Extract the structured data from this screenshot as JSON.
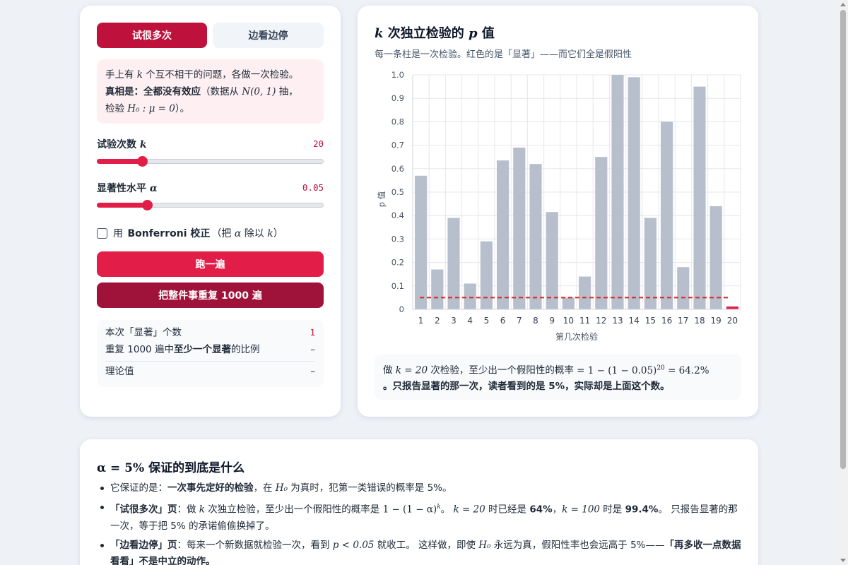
{
  "tabs": {
    "many": "试很多次",
    "peek": "边看边停"
  },
  "intro": {
    "l1a": "手上有",
    "l1k": "k",
    "l1b": "个互不相干的问题，各做一次检验。",
    "l2bold": "真相是：全都没有效应",
    "l2a": "（数据从",
    "l2math": "N(0, 1)",
    "l2b": "抽，",
    "l3a": "检验",
    "l3math": "H₀ : μ = 0",
    "l3b": "）。"
  },
  "controls": {
    "k_label": "试验次数",
    "k_sym": "k",
    "k_value": "20",
    "k_fraction": 0.2,
    "alpha_label": "显著性水平",
    "alpha_sym": "α",
    "alpha_value": "0.05",
    "alpha_fraction": 0.22,
    "bonf_a": "用",
    "bonf_b": "Bonferroni 校正",
    "bonf_c": "（把",
    "bonf_alpha": "α",
    "bonf_d": "除以",
    "bonf_k": "k",
    "bonf_e": "）",
    "bonf_checked": false
  },
  "buttons": {
    "run": "跑一遍",
    "repeat": "把整件事重复 1000 遍"
  },
  "stats": {
    "count_label": "本次「显著」个数",
    "count_value": "1",
    "ratio_a": "重复 1000 遍中",
    "ratio_bold": "至少一个显著",
    "ratio_b": "的比例",
    "ratio_value": "–",
    "theory_label": "理论值",
    "theory_value": "–"
  },
  "chart_header": {
    "title_k": "k",
    "title_a": " 次独立检验的 ",
    "title_p": "p",
    "title_b": " 值",
    "subtitle": "每一条柱是一次检验。红色的是「显著」——而它们全是假阳性"
  },
  "chart_data": {
    "type": "bar",
    "categories": [
      "1",
      "2",
      "3",
      "4",
      "5",
      "6",
      "7",
      "8",
      "9",
      "10",
      "11",
      "12",
      "13",
      "14",
      "15",
      "16",
      "17",
      "18",
      "19",
      "20"
    ],
    "values": [
      0.57,
      0.17,
      0.39,
      0.11,
      0.29,
      0.635,
      0.69,
      0.62,
      0.415,
      0.05,
      0.14,
      0.65,
      1.0,
      0.99,
      0.39,
      0.8,
      0.18,
      0.95,
      0.44,
      0.012
    ],
    "significant": [
      false,
      false,
      false,
      false,
      false,
      false,
      false,
      false,
      false,
      false,
      false,
      false,
      false,
      false,
      false,
      false,
      false,
      false,
      false,
      true
    ],
    "threshold": 0.05,
    "xlabel": "第几次检验",
    "ylabel": "p 值",
    "ylim": [
      0,
      1
    ],
    "yticks": [
      "0",
      "0.1",
      "0.2",
      "0.3",
      "0.4",
      "0.5",
      "0.6",
      "0.7",
      "0.8",
      "0.9",
      "1.0"
    ],
    "colors": {
      "bar": "#b8bfcc",
      "significant": "#e11d48",
      "threshold": "#dc2626",
      "grid": "#e5e7eb"
    },
    "grid": true
  },
  "result": {
    "a": "做",
    "math1": "k = 20",
    "b": "次检验，至少出一个假阳性的概率",
    "math2": "= 1 − (1 − 0.05)",
    "sup": "20",
    "math3": " = 64.2%",
    "bold": "。只报告显著的那一次，读者看到的是 5%，实际却是上面这个数。"
  },
  "bottom": {
    "title_math": "α = 5%",
    "title_text": " 保证的到底是什么",
    "b1a": "它保证的是：",
    "b1bold": "一次事先定好的检验",
    "b1b": "，在",
    "b1math": "H₀",
    "b1c": "为真时，犯第一类错误的概率是 5%。",
    "b2tag": "「试很多次」页",
    "b2a": "：做",
    "b2k": "k",
    "b2b": "次独立检验，至少出一个假阳性的概率是",
    "b2math": "1 − (1 − α)",
    "b2sup": "k",
    "b2c": "。",
    "b2math2": "k = 20",
    "b2d": "时已经是",
    "b2v1": "64%",
    "b2e": "，",
    "b2math3": "k = 100",
    "b2f": "时是",
    "b2v2": "99.4%",
    "b2g": "。 只报告显著的那一次，等于把 5% 的承诺偷偷换掉了。",
    "b3tag": "「边看边停」页",
    "b3a": "：每来一个新数据就检验一次，看到",
    "b3math": "p < 0.05",
    "b3b": "就收工。 这样做，即使",
    "b3math2": "H₀",
    "b3c": "永远为真，假阳性率也会远高于 5%——",
    "b3bold": "「再多收一点数据看看」不是中立的动作。"
  }
}
